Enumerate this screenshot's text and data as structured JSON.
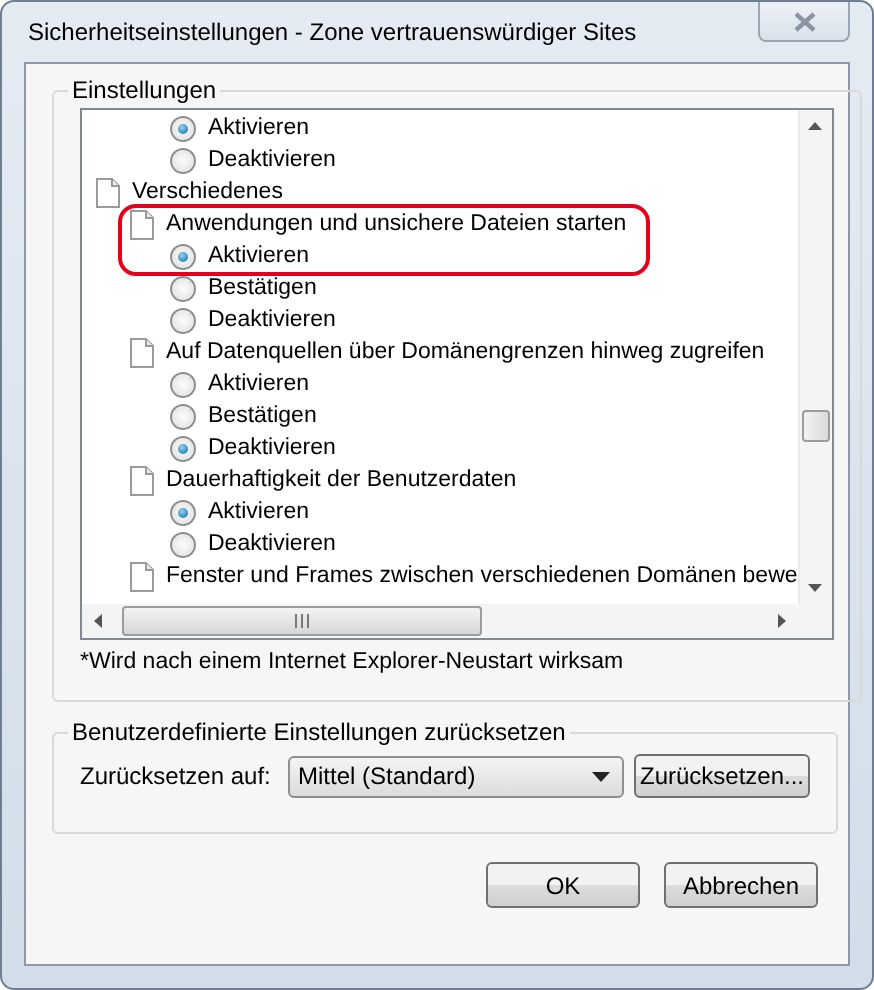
{
  "window": {
    "title": "Sicherheitseinstellungen - Zone vertrauenswürdiger Sites"
  },
  "settings_group": {
    "title": "Einstellungen",
    "tree": [
      {
        "kind": "option",
        "label": "Aktivieren",
        "selected": true,
        "highlighted": false
      },
      {
        "kind": "option",
        "label": "Deaktivieren",
        "selected": false,
        "highlighted": false
      },
      {
        "kind": "category",
        "label": "Verschiedenes",
        "highlighted": false,
        "children": [
          {
            "kind": "setting",
            "label": "Anwendungen und unsichere Dateien starten",
            "highlighted": true,
            "children": [
              {
                "kind": "option",
                "label": "Aktivieren",
                "selected": true,
                "highlighted": true
              },
              {
                "kind": "option",
                "label": "Bestätigen",
                "selected": false,
                "highlighted": false
              },
              {
                "kind": "option",
                "label": "Deaktivieren",
                "selected": false,
                "highlighted": false
              }
            ]
          },
          {
            "kind": "setting",
            "label": "Auf Datenquellen über Domänengrenzen hinweg zugreifen",
            "highlighted": false,
            "children": [
              {
                "kind": "option",
                "label": "Aktivieren",
                "selected": false,
                "highlighted": false
              },
              {
                "kind": "option",
                "label": "Bestätigen",
                "selected": false,
                "highlighted": false
              },
              {
                "kind": "option",
                "label": "Deaktivieren",
                "selected": true,
                "highlighted": false
              }
            ]
          },
          {
            "kind": "setting",
            "label": "Dauerhaftigkeit der Benutzerdaten",
            "highlighted": false,
            "children": [
              {
                "kind": "option",
                "label": "Aktivieren",
                "selected": true,
                "highlighted": false
              },
              {
                "kind": "option",
                "label": "Deaktivieren",
                "selected": false,
                "highlighted": false
              }
            ]
          },
          {
            "kind": "setting",
            "label": "Fenster und Frames zwischen verschiedenen Domänen bewe",
            "highlighted": false
          }
        ]
      }
    ],
    "note": "*Wird nach einem Internet Explorer-Neustart wirksam"
  },
  "reset_group": {
    "title": "Benutzerdefinierte Einstellungen zurücksetzen",
    "label": "Zurücksetzen auf:",
    "dropdown_value": "Mittel (Standard)",
    "reset_button": "Zurücksetzen..."
  },
  "buttons": [
    "OK",
    "Abbrechen"
  ]
}
